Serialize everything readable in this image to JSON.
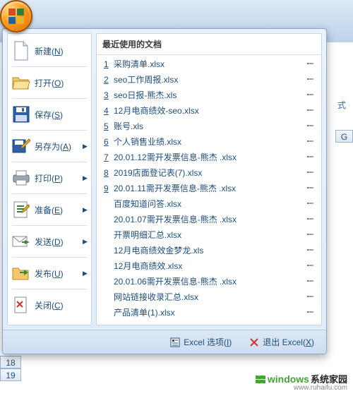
{
  "left_menu": {
    "new_label": "新建(N)",
    "open_label": "打开(O)",
    "save_label": "保存(S)",
    "saveas_label": "另存为(A)",
    "print_label": "打印(P)",
    "prepare_label": "准备(E)",
    "send_label": "发送(D)",
    "publish_label": "发布(U)",
    "close_label": "关闭(C)"
  },
  "recent": {
    "header": "最近使用的文档",
    "items": [
      {
        "num": "1",
        "name": "采购清单.xlsx"
      },
      {
        "num": "2",
        "name": "seo工作周报.xlsx"
      },
      {
        "num": "3",
        "name": "seo日报-熊杰.xls"
      },
      {
        "num": "4",
        "name": "12月电商绩效-seo.xlsx"
      },
      {
        "num": "5",
        "name": "账号.xls"
      },
      {
        "num": "6",
        "name": "个人销售业绩.xlsx"
      },
      {
        "num": "7",
        "name": "20.01.12需开发票信息-熊杰 .xlsx"
      },
      {
        "num": "8",
        "name": "2019店面登记表(7).xlsx"
      },
      {
        "num": "9",
        "name": "20.01.11需开发票信息-熊杰 .xlsx"
      },
      {
        "num": "",
        "name": "百度知道问答.xlsx"
      },
      {
        "num": "",
        "name": "20.01.07需开发票信息-熊杰 .xlsx"
      },
      {
        "num": "",
        "name": "开票明细汇总.xlsx"
      },
      {
        "num": "",
        "name": "12月电商绩效金梦龙.xls"
      },
      {
        "num": "",
        "name": "12月电商绩效.xlsx"
      },
      {
        "num": "",
        "name": "20.01.06需开发票信息-熊杰 .xlsx"
      },
      {
        "num": "",
        "name": "网站链接收录汇总.xlsx"
      },
      {
        "num": "",
        "name": "产品清单(1).xlsx"
      }
    ]
  },
  "footer": {
    "options_label": "Excel 选项(I)",
    "exit_label": "退出 Excel(X)"
  },
  "sheet": {
    "col_label": "G",
    "row_18": "18",
    "row_19": "19",
    "group_label": "式"
  },
  "watermark": {
    "brand_latin": "windows",
    "brand_cn": "系统家园",
    "url": "www.ruhaifu.com"
  }
}
